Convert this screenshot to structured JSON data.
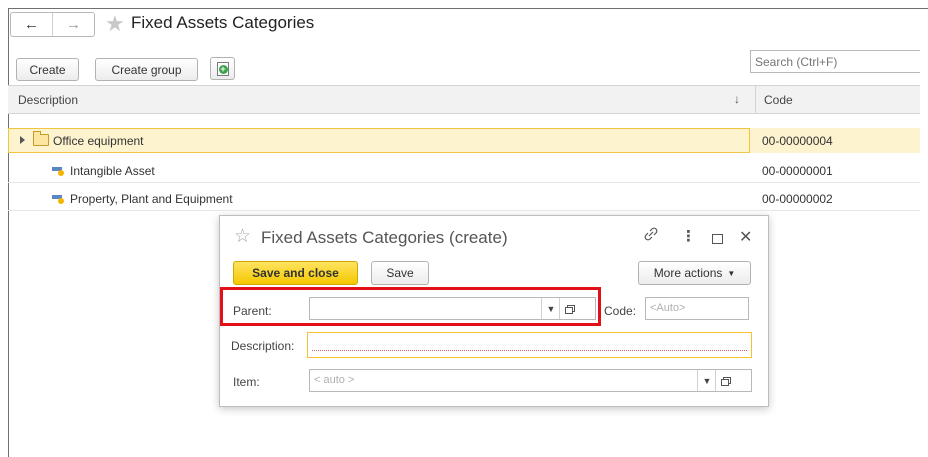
{
  "window": {
    "title": "Fixed Assets Categories",
    "back_glyph": "←",
    "forward_glyph": "→"
  },
  "toolbar": {
    "create_label": "Create",
    "create_group_label": "Create group",
    "search_placeholder": "Search (Ctrl+F)"
  },
  "table": {
    "columns": {
      "description": "Description",
      "sort_glyph": "↓",
      "code": "Code"
    },
    "rows": [
      {
        "description": "Office equipment",
        "code": "00-00000004",
        "kind": "group",
        "selected": true
      },
      {
        "description": "Intangible Asset",
        "code": "00-00000001",
        "kind": "item"
      },
      {
        "description": "Property, Plant and Equipment",
        "code": "00-00000002",
        "kind": "item"
      }
    ]
  },
  "dialog": {
    "title": "Fixed Assets Categories (create)",
    "save_and_close_label": "Save and close",
    "save_label": "Save",
    "more_actions_label": "More actions",
    "parent_label": "Parent:",
    "parent_value": "",
    "code_label": "Code:",
    "code_placeholder": "<Auto>",
    "description_label": "Description:",
    "description_value": "",
    "item_label": "Item:",
    "item_placeholder": "< auto >"
  },
  "colors": {
    "selected_row": "#fdf3cf",
    "primary_button": "#f4c800",
    "highlight_border": "#e3101a",
    "focus_border": "#f2c232"
  }
}
